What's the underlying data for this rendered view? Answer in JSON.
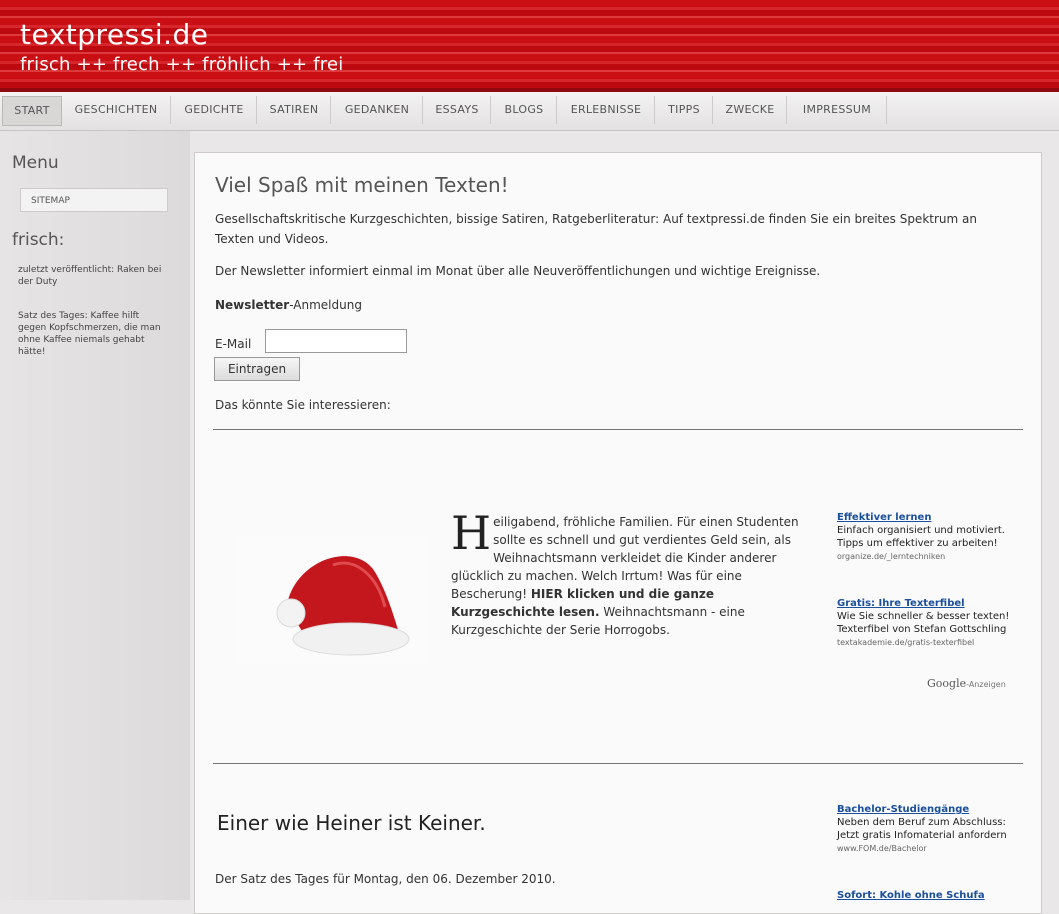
{
  "header": {
    "title": "textpressi.de",
    "tagline": "frisch ++ frech ++ fröhlich ++ frei"
  },
  "nav": {
    "items": [
      "START",
      "GESCHICHTEN",
      "GEDICHTE",
      "SATIREN",
      "GEDANKEN",
      "ESSAYS",
      "BLOGS",
      "ERLEBNISSE",
      "TIPPS",
      "ZWECKE",
      "IMPRESSUM"
    ]
  },
  "sidebar": {
    "menu_heading": "Menu",
    "sitemap_label": "SITEMAP",
    "frisch_heading": "frisch:",
    "frisch_text_1": "zuletzt veröffentlicht: Raken bei der Duty",
    "frisch_text_2": "Satz des Tages: Kaffee hilft gegen Kopfschmerzen, die man ohne Kaffee niemals gehabt hätte!"
  },
  "content": {
    "headline": "Viel Spaß mit meinen Texten!",
    "intro": "Gesellschaftskritische Kurzgeschichten, bissige Satiren, Ratgeberliteratur: Auf textpressi.de finden Sie ein breites Spektrum an Texten und Videos.",
    "newsletter_text": "Der Newsletter informiert einmal im Monat über alle Neuveröffentlichungen und wichtige Ereignisse.",
    "newsletter_bold": "Newsletter",
    "newsletter_rest": "-Anmeldung",
    "email_label": "E-Mail",
    "submit_label": "Eintragen",
    "interest_text": "Das könnte Sie interessieren:",
    "story_dropcap": "H",
    "story_text_1": "eiligabend, fröhliche Familien. Für einen Studenten sollte es schnell und gut verdientes Geld sein, als Weihnachtsmann verkleidet die Kinder anderer glücklich zu machen. Welch Irrtum! Was für eine Bescherung!",
    "story_link": "HIER klicken und die ganze Kurzgeschichte lesen.",
    "story_text_2": "Weihnachtsmann - eine Kurzgeschichte der Serie Horrogobs.",
    "ads": [
      {
        "title": "Effektiver lernen",
        "text": "Einfach organisiert und motiviert. Tipps um effektiver zu arbeiten!",
        "url": "organize.de/_lerntechniken"
      },
      {
        "title": "Gratis: Ihre Texterfibel",
        "text": "Wie Sie schneller & besser texten! Texterfibel von Stefan Gottschling",
        "url": "textakademie.de/gratis-texterfibel"
      },
      {
        "title": "Bachelor-Studiengänge",
        "text": "Neben dem Beruf zum Abschluss: Jetzt gratis Infomaterial anfordern",
        "url": "www.FOM.de/Bachelor"
      },
      {
        "title": "Sofort: Kohle ohne Schufa",
        "text": "",
        "url": ""
      }
    ],
    "google_label": "Google",
    "google_sub": "-Anzeigen",
    "section_title": "Einer wie Heiner ist Keiner.",
    "section_text": "Der Satz des Tages für Montag, den 06. Dezember 2010."
  }
}
